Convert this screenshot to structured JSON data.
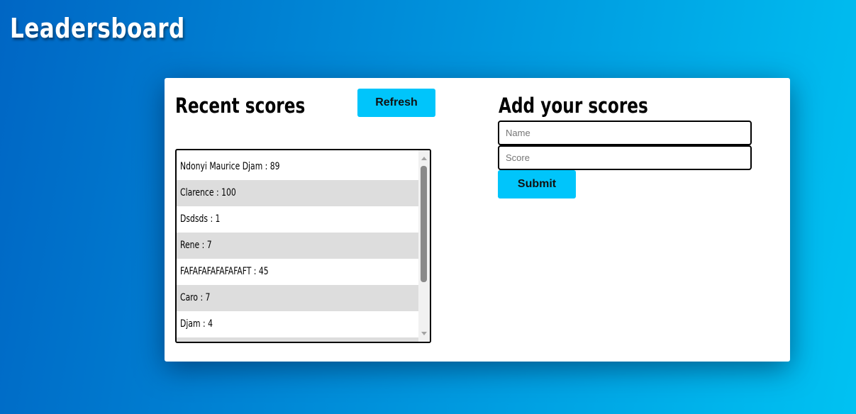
{
  "header": {
    "title": "Leadersboard"
  },
  "recent": {
    "title": "Recent scores",
    "refresh_label": "Refresh",
    "scores": [
      "Ndonyi Maurice Djam : 89",
      "Clarence : 100",
      "Dsdsds : 1",
      "Rene : 7",
      "FAFAFAFAFAFAFAFT : 45",
      "Caro : 7",
      "Djam : 4",
      ""
    ]
  },
  "add": {
    "title": "Add your scores",
    "name_placeholder": "Name",
    "score_placeholder": "Score",
    "submit_label": "Submit"
  },
  "colors": {
    "accent": "#00c5fb",
    "gradient_start": "#0066c4",
    "gradient_end": "#00c2f2",
    "row_alt": "#dddddd"
  }
}
